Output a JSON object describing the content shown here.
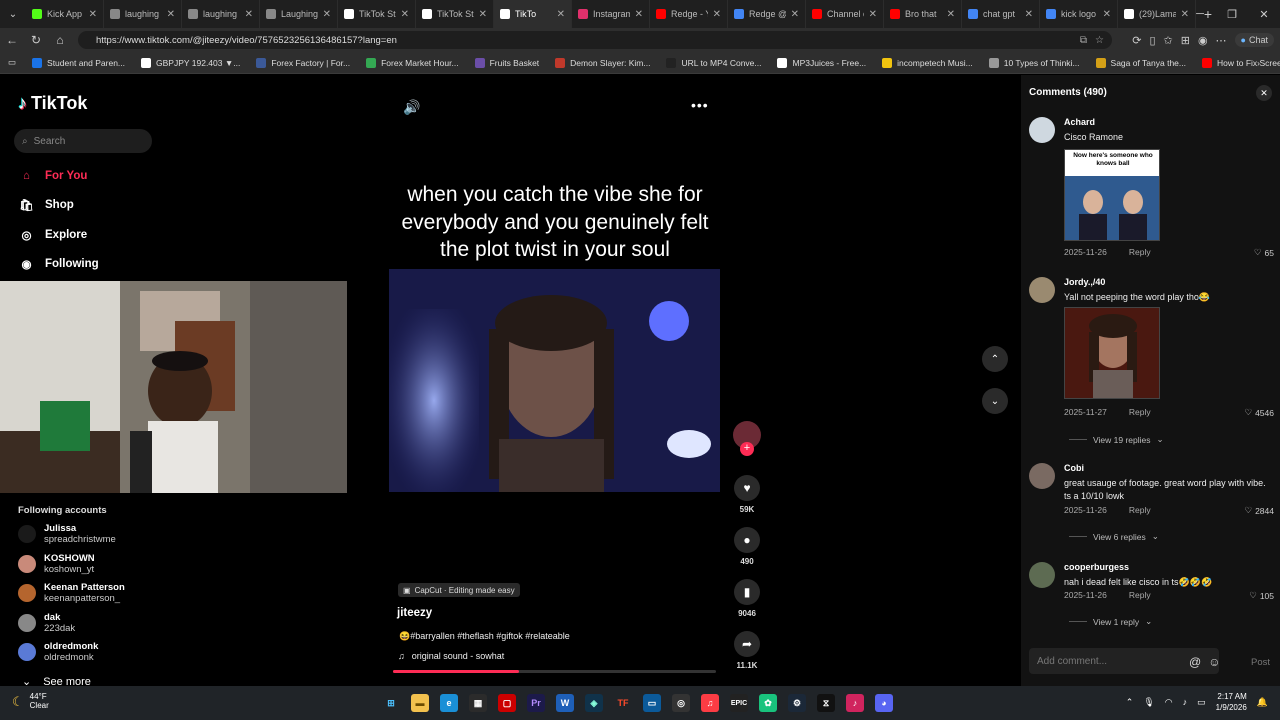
{
  "browser": {
    "tabs": [
      {
        "label": "Kick App",
        "color": "#53fc18",
        "active": false
      },
      {
        "label": "laughing",
        "color": "#888888",
        "active": false
      },
      {
        "label": "laughing",
        "color": "#888888",
        "active": false
      },
      {
        "label": "Laughing",
        "color": "#888888",
        "active": false
      },
      {
        "label": "TikTok St",
        "color": "#ffffff",
        "active": false
      },
      {
        "label": "TikTok St",
        "color": "#ffffff",
        "active": false
      },
      {
        "label": "TikTo",
        "color": "#ffffff",
        "active": true
      },
      {
        "label": "Instagram",
        "color": "#e1306c",
        "active": false
      },
      {
        "label": "Redge - Y",
        "color": "#ff0000",
        "active": false
      },
      {
        "label": "Redge @",
        "color": "#4285f4",
        "active": false
      },
      {
        "label": "Channel c",
        "color": "#ff0000",
        "active": false
      },
      {
        "label": "Bro that",
        "color": "#ff0000",
        "active": false
      },
      {
        "label": "chat gpt",
        "color": "#4285f4",
        "active": false
      },
      {
        "label": "kick logo",
        "color": "#4285f4",
        "active": false
      },
      {
        "label": "(29)Lama",
        "color": "#ffffff",
        "active": false
      }
    ],
    "url": "https://www.tiktok.com/@jiteezy/video/7576523256136486157?lang=en",
    "chat_label": "Chat",
    "bookmarks": [
      {
        "label": "Student and Paren...",
        "color": "#1a73e8"
      },
      {
        "label": "GBPJPY 192.403 ▼...",
        "color": "#ffffff"
      },
      {
        "label": "Forex Factory | For...",
        "color": "#3b5998"
      },
      {
        "label": "Forex Market Hour...",
        "color": "#34a853"
      },
      {
        "label": "Fruits Basket",
        "color": "#6b4ea8"
      },
      {
        "label": "Demon Slayer: Kim...",
        "color": "#c0392b"
      },
      {
        "label": "URL to MP4 Conve...",
        "color": "#222222"
      },
      {
        "label": "MP3Juices - Free...",
        "color": "#ffffff"
      },
      {
        "label": "incompetech Musi...",
        "color": "#f1c40f"
      },
      {
        "label": "10 Types of Thinki...",
        "color": "#999999"
      },
      {
        "label": "Saga of Tanya the...",
        "color": "#d4a017"
      },
      {
        "label": "How to Fix Screen...",
        "color": "#ff0000"
      }
    ]
  },
  "tiktok": {
    "logo_text": "TikTok",
    "search_placeholder": "Search",
    "nav": [
      {
        "label": "For You",
        "icon": "home-icon"
      },
      {
        "label": "Shop",
        "icon": "shop-icon"
      },
      {
        "label": "Explore",
        "icon": "compass-icon"
      },
      {
        "label": "Following",
        "icon": "following-icon"
      }
    ],
    "following_title": "Following accounts",
    "following": [
      {
        "name": "Julissa",
        "user": "spreadchristwme",
        "color": "#1a1a1a"
      },
      {
        "name": "KOSHOWN",
        "user": "koshown_yt",
        "color": "#c98a7a"
      },
      {
        "name": "Keenan Patterson",
        "user": "keenanpatterson_",
        "color": "#b5652e"
      },
      {
        "name": "dak",
        "user": "223dak",
        "color": "#888888"
      },
      {
        "name": "oldredmonk",
        "user": "oldredmonk",
        "color": "#5a7ad6"
      }
    ],
    "see_more": "See more",
    "video": {
      "caption": "when you catch the vibe she for everybody and you genuinely felt the plot twist in your soul",
      "capcut": "CapCut · Editing made easy",
      "author": "jiteezy",
      "tags": "😆#barryallen #theflash #giftok #relateable",
      "sound": "original sound - sowhat",
      "progress": 0.39,
      "likes": "59K",
      "comments": "490",
      "saves": "9046",
      "shares": "11.1K"
    },
    "comments_panel": {
      "title": "Comments (490)",
      "add_placeholder": "Add comment...",
      "post_label": "Post",
      "items": [
        {
          "name": "Achard",
          "text": "Cisco Ramone",
          "date": "2025-11-26",
          "reply": "Reply",
          "likes": "65",
          "gif_caption": "Now here's someone who knows ball",
          "replies": ""
        },
        {
          "name": "Jordy.,/40",
          "text": "Yall not peeping the word play tho😂",
          "date": "2025-11-27",
          "reply": "Reply",
          "likes": "4546",
          "gif_caption": "",
          "replies": "View 19 replies"
        },
        {
          "name": "Cobi",
          "text": "great usauge of footage. great word play with vibe. ts a 10/10 lowk",
          "date": "2025-11-26",
          "reply": "Reply",
          "likes": "2844",
          "gif_caption": "",
          "replies": "View 6 replies"
        },
        {
          "name": "cooperburgess",
          "text": "nah i dead felt like cisco in ts🤣🤣🤣",
          "date": "2025-11-26",
          "reply": "Reply",
          "likes": "105",
          "gif_caption": "",
          "replies": "View 1 reply"
        }
      ]
    }
  },
  "taskbar": {
    "temp": "44°F",
    "weather": "Clear",
    "time": "2:17 AM",
    "date": "1/9/2026"
  }
}
